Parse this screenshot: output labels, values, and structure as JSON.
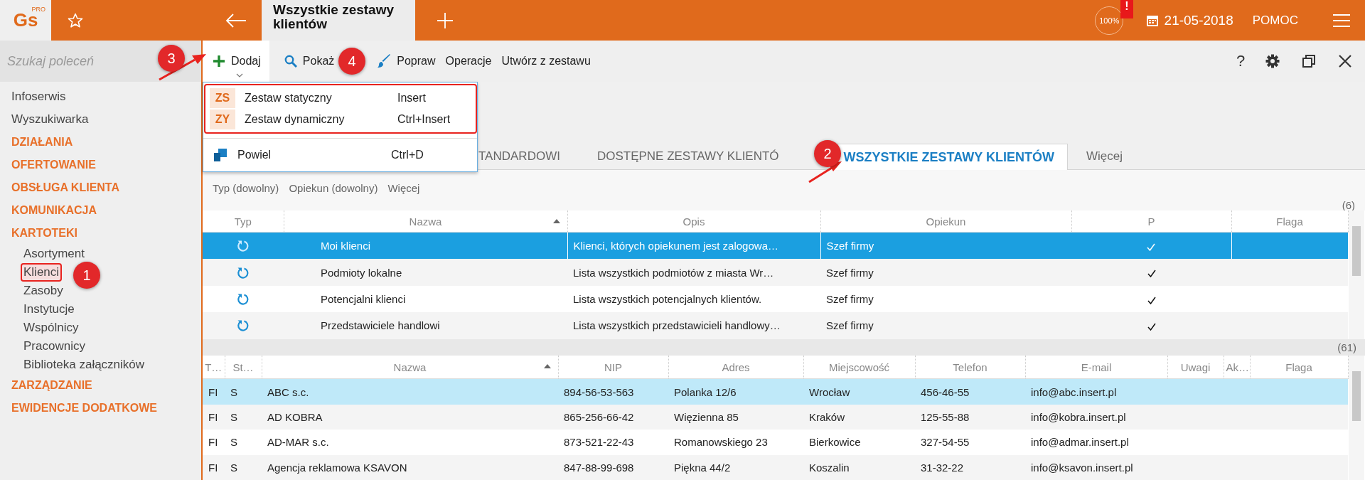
{
  "header": {
    "logo": "Gs",
    "logo_badge": "PRO",
    "document_tab": "Wszystkie zestawy klientów",
    "zoom": "100%",
    "alert": "!",
    "date": "21-05-2018",
    "help": "POMOC"
  },
  "sidebar": {
    "search_placeholder": "Szukaj poleceń",
    "items": [
      {
        "label": "Infoserwis",
        "kind": "link"
      },
      {
        "label": "Wyszukiwarka",
        "kind": "link"
      },
      {
        "label": "DZIAŁANIA",
        "kind": "section"
      },
      {
        "label": "OFERTOWANIE",
        "kind": "section"
      },
      {
        "label": "OBSŁUGA KLIENTA",
        "kind": "section"
      },
      {
        "label": "KOMUNIKACJA",
        "kind": "section"
      },
      {
        "label": "KARTOTEKI",
        "kind": "section",
        "children": [
          {
            "label": "Asortyment",
            "selected": false
          },
          {
            "label": "Klienci",
            "selected": true
          },
          {
            "label": "Zasoby",
            "selected": false
          },
          {
            "label": "Instytucje",
            "selected": false
          },
          {
            "label": "Wspólnicy",
            "selected": false
          },
          {
            "label": "Pracownicy",
            "selected": false
          },
          {
            "label": "Biblioteka załączników",
            "selected": false
          }
        ]
      },
      {
        "label": "ZARZĄDZANIE",
        "kind": "section"
      },
      {
        "label": "EWIDENCJE DODATKOWE",
        "kind": "section"
      }
    ]
  },
  "toolbar": {
    "buttons": [
      {
        "label": "Dodaj",
        "kind": "add",
        "open": true
      },
      {
        "label": "Pokaż",
        "kind": "search",
        "open": false
      },
      {
        "label": "Popraw",
        "kind": "brush",
        "open": false
      },
      {
        "label": "Operacje",
        "kind": "text",
        "open": false
      },
      {
        "label": "Utwórz z zestawu",
        "kind": "text",
        "open": false
      }
    ],
    "help": "?"
  },
  "dropdown": {
    "items": [
      {
        "kind": "code",
        "code": "ZS",
        "label": "Zestaw statyczny",
        "shortcut": "Insert"
      },
      {
        "kind": "code",
        "code": "ZY",
        "label": "Zestaw dynamiczny",
        "shortcut": "Ctrl+Insert"
      },
      {
        "kind": "copy",
        "label": "Powiel",
        "shortcut": "Ctrl+D"
      }
    ]
  },
  "tabs": [
    {
      "label": "TANDARDOWI",
      "selected": false
    },
    {
      "label": "DOSTĘPNE ZESTAWY KLIENTÓ",
      "selected": false
    },
    {
      "label": "WSZYSTKIE ZESTAWY KLIENTÓW",
      "selected": true
    },
    {
      "label": "Więcej",
      "selected": false
    }
  ],
  "filters": [
    "Typ (dowolny)",
    "Opiekun (dowolny)",
    "Więcej"
  ],
  "sets_table": {
    "count": "(6)",
    "columns": [
      {
        "label": "Typ",
        "sorted": false
      },
      {
        "label": "Nazwa",
        "sorted": true
      },
      {
        "label": "Opis",
        "sorted": false
      },
      {
        "label": "Opiekun",
        "sorted": false
      },
      {
        "label": "P",
        "sorted": false
      },
      {
        "label": "Flaga",
        "sorted": false
      }
    ],
    "rows": [
      {
        "kind": "dynamic",
        "name": "Moi klienci",
        "description": "Klienci, których opiekunem jest zalogowa…",
        "owner": "Szef firmy",
        "p": true,
        "selected": true
      },
      {
        "kind": "dynamic",
        "name": "Podmioty lokalne",
        "description": "Lista wszystkich podmiotów z miasta Wr…",
        "owner": "Szef firmy",
        "p": true,
        "selected": false
      },
      {
        "kind": "dynamic",
        "name": "Potencjalni klienci",
        "description": "Lista wszystkich potencjalnych klientów.",
        "owner": "Szef firmy",
        "p": true,
        "selected": false
      },
      {
        "kind": "dynamic",
        "name": "Przedstawiciele handlowi",
        "description": "Lista wszystkich przedstawicieli handlowy…",
        "owner": "Szef firmy",
        "p": true,
        "selected": false
      }
    ]
  },
  "clients_table": {
    "count": "(61)",
    "columns": [
      {
        "label": "T…",
        "sorted": false
      },
      {
        "label": "St…",
        "sorted": false
      },
      {
        "label": "Nazwa",
        "sorted": true
      },
      {
        "label": "NIP",
        "sorted": false
      },
      {
        "label": "Adres",
        "sorted": false
      },
      {
        "label": "Miejscowość",
        "sorted": false
      },
      {
        "label": "Telefon",
        "sorted": false
      },
      {
        "label": "E-mail",
        "sorted": false
      },
      {
        "label": "Uwagi",
        "sorted": false
      },
      {
        "label": "Ak…",
        "sorted": false
      },
      {
        "label": "Flaga",
        "sorted": false
      }
    ],
    "rows": [
      {
        "type": "FI",
        "status": "S",
        "name": "ABC s.c.",
        "nip": "894-56-53-563",
        "address": "Polanka  12/6",
        "city": "Wrocław",
        "phone": "456-46-55",
        "email": "info@abc.insert.pl",
        "selected": true
      },
      {
        "type": "FI",
        "status": "S",
        "name": "AD KOBRA",
        "nip": "865-256-66-42",
        "address": "Więzienna  85",
        "city": "Kraków",
        "phone": "125-55-88",
        "email": "info@kobra.insert.pl",
        "selected": false
      },
      {
        "type": "FI",
        "status": "S",
        "name": "AD-MAR s.c.",
        "nip": "873-521-22-43",
        "address": "Romanowskiego 23",
        "city": "Bierkowice",
        "phone": "327-54-55",
        "email": "info@admar.insert.pl",
        "selected": false
      },
      {
        "type": "FI",
        "status": "S",
        "name": "Agencja reklamowa KSAVON",
        "nip": "847-88-99-698",
        "address": "Piękna  44/2",
        "city": "Koszalin",
        "phone": "31-32-22",
        "email": "info@ksavon.insert.pl",
        "selected": false
      }
    ]
  },
  "annotations": [
    {
      "number": "1"
    },
    {
      "number": "2"
    },
    {
      "number": "3"
    },
    {
      "number": "4"
    }
  ]
}
